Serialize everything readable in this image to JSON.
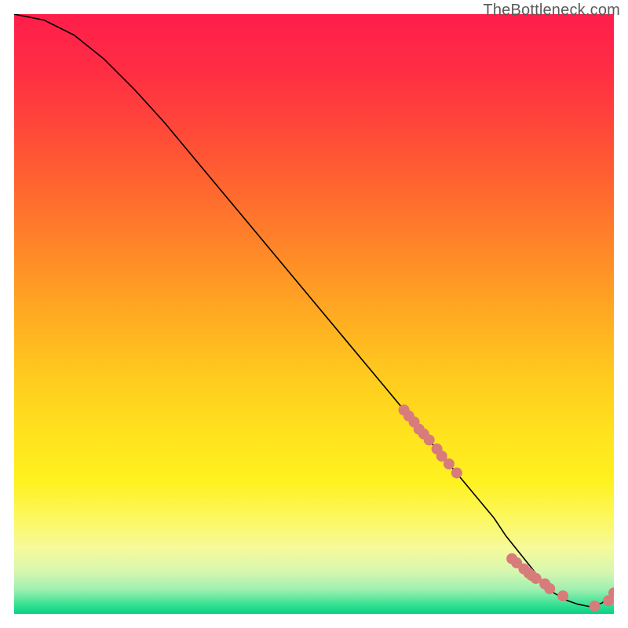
{
  "attribution": "TheBottleneck.com",
  "chart_data": {
    "type": "line",
    "title": "",
    "xlabel": "",
    "ylabel": "",
    "xlim": [
      0,
      100
    ],
    "ylim": [
      0,
      100
    ],
    "grid": false,
    "legend": false,
    "series": [
      {
        "name": "curve",
        "x": [
          0,
          5,
          10,
          15,
          20,
          25,
          30,
          35,
          40,
          45,
          50,
          55,
          60,
          65,
          70,
          75,
          80,
          82,
          84,
          86,
          88,
          90,
          92,
          94,
          96,
          98,
          100
        ],
        "y": [
          100,
          99,
          96.5,
          92.5,
          87.5,
          82,
          76,
          70,
          64,
          58,
          52,
          46,
          40,
          34,
          28,
          22,
          16,
          13,
          10.5,
          8,
          5.5,
          3.5,
          2.3,
          1.6,
          1.2,
          1.8,
          3.5
        ],
        "color": "#000000",
        "marker": false
      },
      {
        "name": "highlight-points",
        "x": [
          65.0,
          65.8,
          66.7,
          67.5,
          68.3,
          69.2,
          70.5,
          71.3,
          72.5,
          73.8,
          83.0,
          83.8,
          85.0,
          85.8,
          86.3,
          87.0,
          88.5,
          89.3,
          91.5,
          96.8,
          99.1,
          100.0
        ],
        "y": [
          34.0,
          33.0,
          32.0,
          30.8,
          30.0,
          29.0,
          27.5,
          26.3,
          25.0,
          23.5,
          9.2,
          8.5,
          7.5,
          6.8,
          6.4,
          5.9,
          5.0,
          4.2,
          3.0,
          1.3,
          2.2,
          3.5
        ],
        "color": "#d87b7b",
        "marker": true
      }
    ],
    "background_gradient": {
      "stops": [
        {
          "pos": 0.0,
          "color": "#ff1e4b"
        },
        {
          "pos": 0.1,
          "color": "#ff2f43"
        },
        {
          "pos": 0.2,
          "color": "#ff4b38"
        },
        {
          "pos": 0.3,
          "color": "#ff6a2f"
        },
        {
          "pos": 0.4,
          "color": "#ff8a28"
        },
        {
          "pos": 0.5,
          "color": "#ffab22"
        },
        {
          "pos": 0.6,
          "color": "#ffca1f"
        },
        {
          "pos": 0.7,
          "color": "#ffe31e"
        },
        {
          "pos": 0.78,
          "color": "#fff220"
        },
        {
          "pos": 0.84,
          "color": "#fcf85f"
        },
        {
          "pos": 0.89,
          "color": "#f7fa9a"
        },
        {
          "pos": 0.93,
          "color": "#d7f7b0"
        },
        {
          "pos": 0.96,
          "color": "#9ef0b0"
        },
        {
          "pos": 0.985,
          "color": "#35e193"
        },
        {
          "pos": 1.0,
          "color": "#07d181"
        }
      ]
    }
  }
}
